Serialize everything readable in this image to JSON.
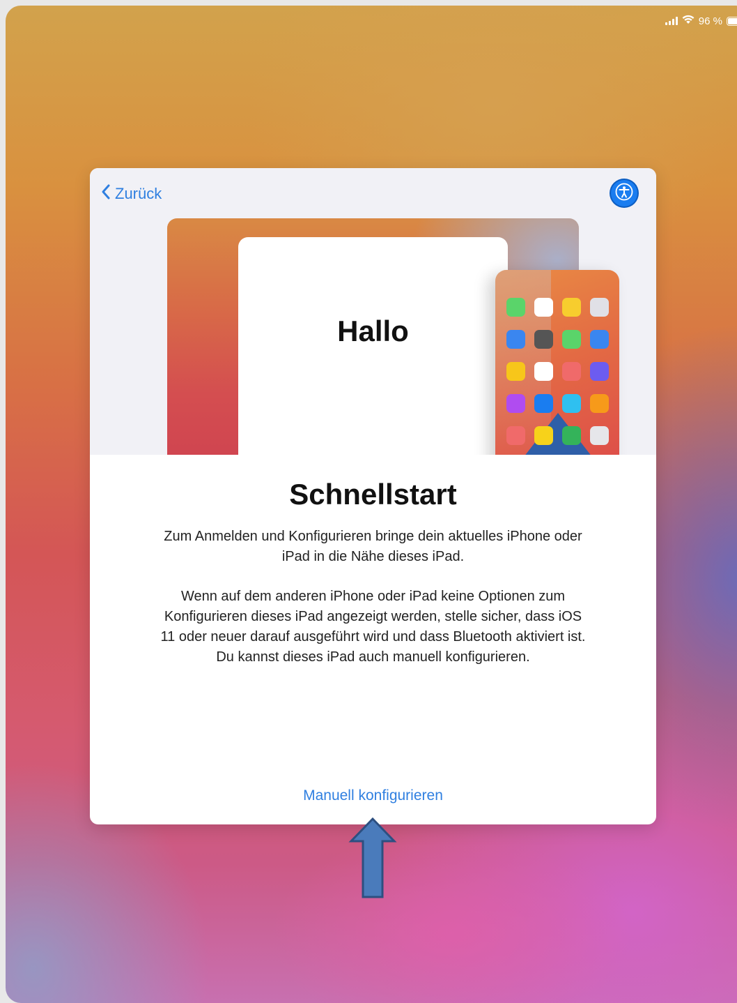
{
  "status_bar": {
    "battery_text": "96 %",
    "icons": [
      "signal-icon",
      "wifi-icon",
      "battery-icon"
    ],
    "battery_level": 0.96
  },
  "nav": {
    "back_label": "Zurück",
    "accessibility_icon": "accessibility-icon"
  },
  "hero": {
    "greeting": "Hallo",
    "app_icon_colors": [
      "#5ad46a",
      "#ffffff",
      "#f7cd2e",
      "#e0e0e6",
      "#3a86f0",
      "#555555",
      "#5ad46a",
      "#3a86f0",
      "#f7c61a",
      "#ffffff",
      "#f06a6a",
      "#6c5cf0",
      "#b04cf0",
      "#1a7df0",
      "#2fc0f0",
      "#f79a1a",
      "#f06a6a",
      "#f7d21a",
      "#34b35a",
      "#e6e6ea"
    ]
  },
  "content": {
    "title": "Schnellstart",
    "paragraph1": "Zum Anmelden und Konfigurieren bringe dein aktuelles iPhone oder iPad in die Nähe dieses iPad.",
    "paragraph2": "Wenn auf dem anderen iPhone oder iPad keine Optionen zum Konfigurieren dieses iPad angezeigt werden, stelle sicher, dass iOS 11 oder neuer darauf ausgeführt wird und dass Bluetooth aktiviert ist. Du kannst dieses iPad auch manuell konfigurieren.",
    "manual_link": "Manuell konfigurieren"
  },
  "colors": {
    "accent": "#2f7fe0",
    "annotation_arrow_fill": "#4a7bbb",
    "annotation_arrow_stroke": "#2d4f80"
  }
}
